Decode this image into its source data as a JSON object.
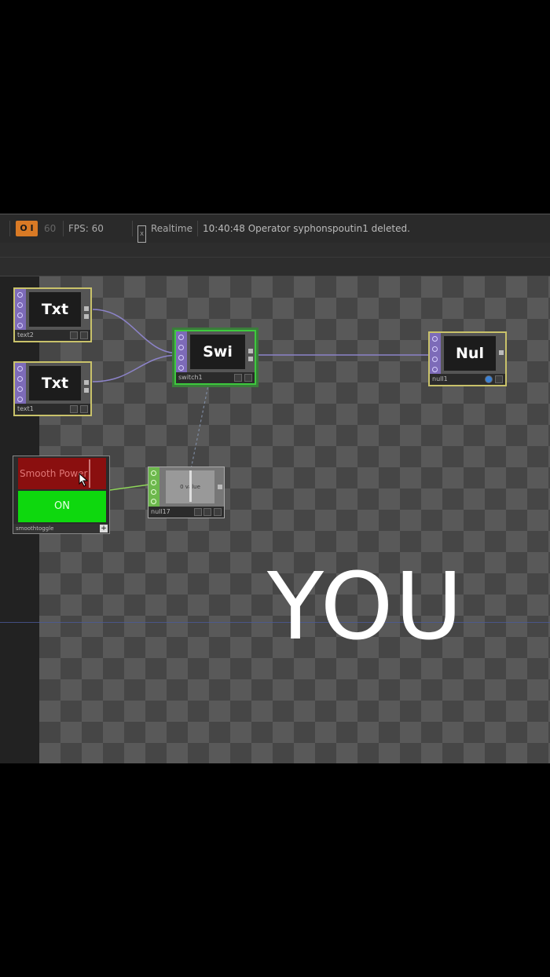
{
  "status": {
    "pause": "O I",
    "frame": "60",
    "fps": "FPS:  60",
    "realtime_box": "X",
    "realtime": "Realtime",
    "log": "10:40:48 Operator syphonspoutin1 deleted."
  },
  "nodes": {
    "text2": {
      "viewer": "Txt",
      "label": "text2"
    },
    "text1": {
      "viewer": "Txt",
      "label": "text1"
    },
    "switch1": {
      "viewer": "Swi",
      "label": "switch1"
    },
    "null1": {
      "viewer": "Nul",
      "label": "null1"
    },
    "null17": {
      "viewer": "0 value",
      "label": "null17"
    },
    "smooth": {
      "top": "Smooth Power",
      "button": "ON",
      "label": "smoothtoggle",
      "plus": "+"
    }
  },
  "canvas_text": "YOU",
  "colors": {
    "accent_orange": "#d97a25",
    "on_green": "#0ed80e",
    "off_red": "#8a0f0f",
    "wire": "#8c83c9",
    "selected": "#3ec93e"
  }
}
